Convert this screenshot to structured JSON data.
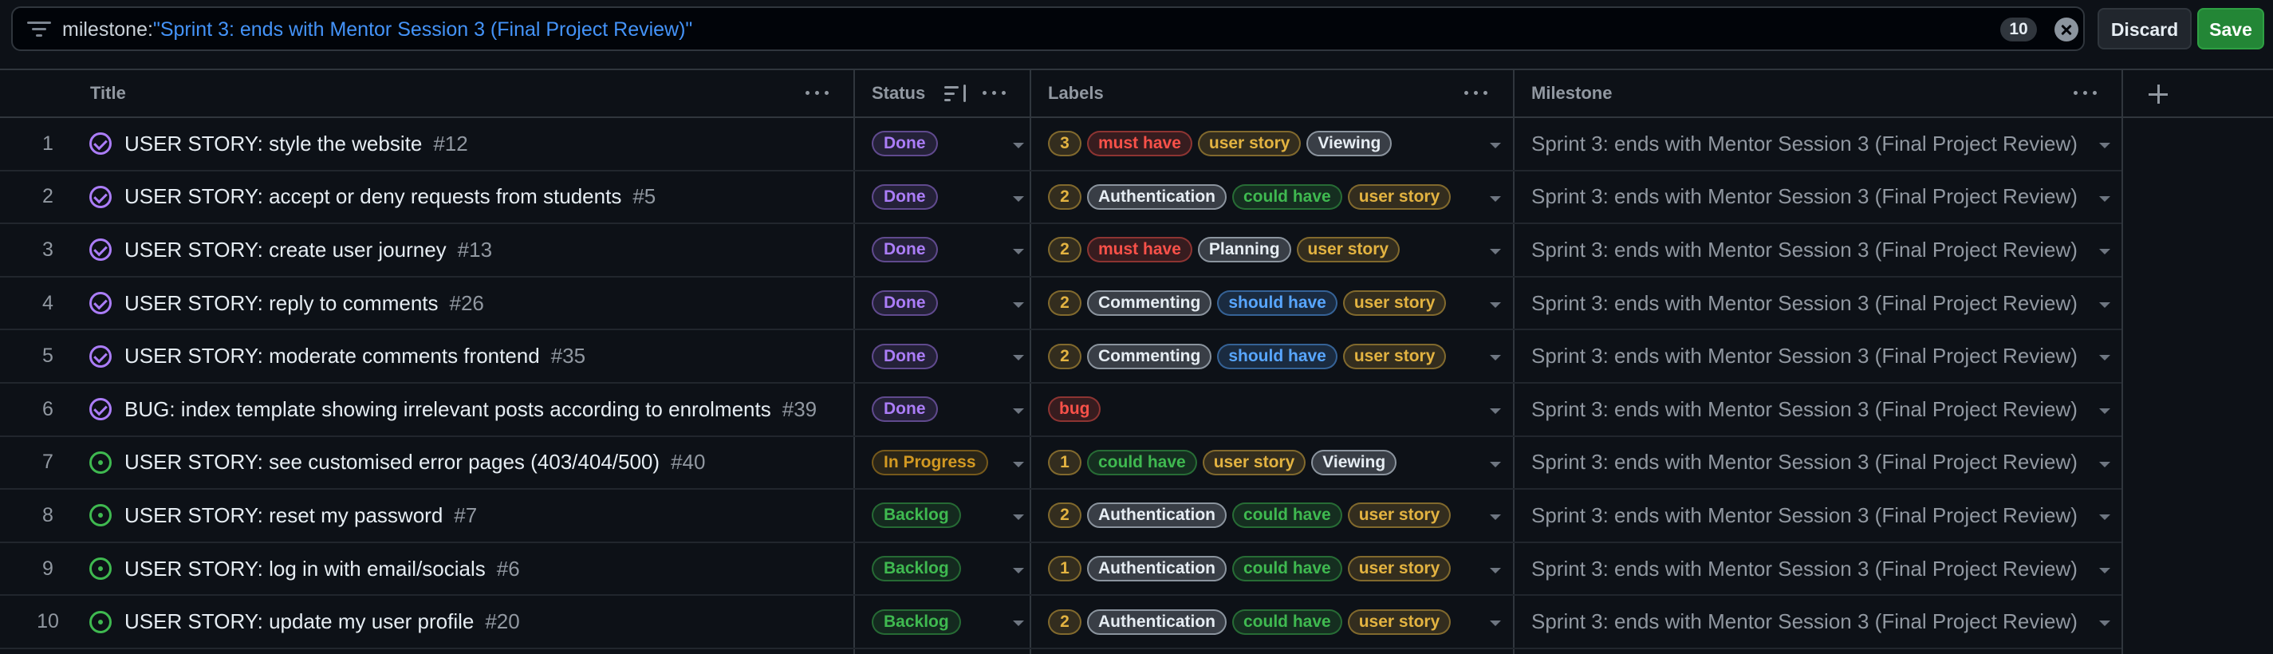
{
  "filter": {
    "key": "milestone:",
    "value": "\"Sprint 3: ends with Mentor Session 3 (Final Project Review)\"",
    "count": "10",
    "discard_label": "Discard",
    "save_label": "Save"
  },
  "columns": {
    "title": "Title",
    "status": "Status",
    "labels": "Labels",
    "milestone": "Milestone"
  },
  "colors": {
    "done": "#ab7df8",
    "in_progress": "#d29922",
    "backlog": "#3fb950",
    "must_have": "#f85149",
    "user_story": "#e3b341",
    "neutral_label": "#8b949e",
    "could_have": "#3fb950",
    "should_have": "#58a6ff",
    "bug": "#f85149"
  },
  "rows": [
    {
      "num": "1",
      "state": "done",
      "title": "USER STORY: style the website",
      "issue": "#12",
      "status": "Done",
      "status_kind": "done",
      "labels": [
        {
          "text": "3",
          "kind": "count"
        },
        {
          "text": "must have",
          "kind": "must_have"
        },
        {
          "text": "user story",
          "kind": "user_story"
        },
        {
          "text": "Viewing",
          "kind": "neutral"
        }
      ],
      "milestone": "Sprint 3: ends with Mentor Session 3 (Final Project Review)"
    },
    {
      "num": "2",
      "state": "done",
      "title": "USER STORY: accept or deny requests from students",
      "issue": "#5",
      "status": "Done",
      "status_kind": "done",
      "labels": [
        {
          "text": "2",
          "kind": "count"
        },
        {
          "text": "Authentication",
          "kind": "neutral"
        },
        {
          "text": "could have",
          "kind": "could_have"
        },
        {
          "text": "user story",
          "kind": "user_story"
        }
      ],
      "milestone": "Sprint 3: ends with Mentor Session 3 (Final Project Review)"
    },
    {
      "num": "3",
      "state": "done",
      "title": "USER STORY: create user journey",
      "issue": "#13",
      "status": "Done",
      "status_kind": "done",
      "labels": [
        {
          "text": "2",
          "kind": "count"
        },
        {
          "text": "must have",
          "kind": "must_have"
        },
        {
          "text": "Planning",
          "kind": "neutral"
        },
        {
          "text": "user story",
          "kind": "user_story"
        }
      ],
      "milestone": "Sprint 3: ends with Mentor Session 3 (Final Project Review)"
    },
    {
      "num": "4",
      "state": "done",
      "title": "USER STORY: reply to comments",
      "issue": "#26",
      "status": "Done",
      "status_kind": "done",
      "labels": [
        {
          "text": "2",
          "kind": "count"
        },
        {
          "text": "Commenting",
          "kind": "neutral"
        },
        {
          "text": "should have",
          "kind": "should_have"
        },
        {
          "text": "user story",
          "kind": "user_story"
        }
      ],
      "milestone": "Sprint 3: ends with Mentor Session 3 (Final Project Review)"
    },
    {
      "num": "5",
      "state": "done",
      "title": "USER STORY: moderate comments frontend",
      "issue": "#35",
      "status": "Done",
      "status_kind": "done",
      "labels": [
        {
          "text": "2",
          "kind": "count"
        },
        {
          "text": "Commenting",
          "kind": "neutral"
        },
        {
          "text": "should have",
          "kind": "should_have"
        },
        {
          "text": "user story",
          "kind": "user_story"
        }
      ],
      "milestone": "Sprint 3: ends with Mentor Session 3 (Final Project Review)"
    },
    {
      "num": "6",
      "state": "done",
      "title": "BUG: index template showing irrelevant posts according to enrolments",
      "issue": "#39",
      "status": "Done",
      "status_kind": "done",
      "labels": [
        {
          "text": "bug",
          "kind": "bug"
        }
      ],
      "milestone": "Sprint 3: ends with Mentor Session 3 (Final Project Review)"
    },
    {
      "num": "7",
      "state": "open",
      "title": "USER STORY: see customised error pages (403/404/500)",
      "issue": "#40",
      "status": "In Progress",
      "status_kind": "in_progress",
      "labels": [
        {
          "text": "1",
          "kind": "count"
        },
        {
          "text": "could have",
          "kind": "could_have"
        },
        {
          "text": "user story",
          "kind": "user_story"
        },
        {
          "text": "Viewing",
          "kind": "neutral"
        }
      ],
      "milestone": "Sprint 3: ends with Mentor Session 3 (Final Project Review)"
    },
    {
      "num": "8",
      "state": "open",
      "title": "USER STORY: reset my password",
      "issue": "#7",
      "status": "Backlog",
      "status_kind": "backlog",
      "labels": [
        {
          "text": "2",
          "kind": "count"
        },
        {
          "text": "Authentication",
          "kind": "neutral"
        },
        {
          "text": "could have",
          "kind": "could_have"
        },
        {
          "text": "user story",
          "kind": "user_story"
        }
      ],
      "milestone": "Sprint 3: ends with Mentor Session 3 (Final Project Review)"
    },
    {
      "num": "9",
      "state": "open",
      "title": "USER STORY: log in with email/socials",
      "issue": "#6",
      "status": "Backlog",
      "status_kind": "backlog",
      "labels": [
        {
          "text": "1",
          "kind": "count"
        },
        {
          "text": "Authentication",
          "kind": "neutral"
        },
        {
          "text": "could have",
          "kind": "could_have"
        },
        {
          "text": "user story",
          "kind": "user_story"
        }
      ],
      "milestone": "Sprint 3: ends with Mentor Session 3 (Final Project Review)"
    },
    {
      "num": "10",
      "state": "open",
      "title": "USER STORY: update my user profile",
      "issue": "#20",
      "status": "Backlog",
      "status_kind": "backlog",
      "labels": [
        {
          "text": "2",
          "kind": "count"
        },
        {
          "text": "Authentication",
          "kind": "neutral"
        },
        {
          "text": "could have",
          "kind": "could_have"
        },
        {
          "text": "user story",
          "kind": "user_story"
        }
      ],
      "milestone": "Sprint 3: ends with Mentor Session 3 (Final Project Review)"
    }
  ]
}
